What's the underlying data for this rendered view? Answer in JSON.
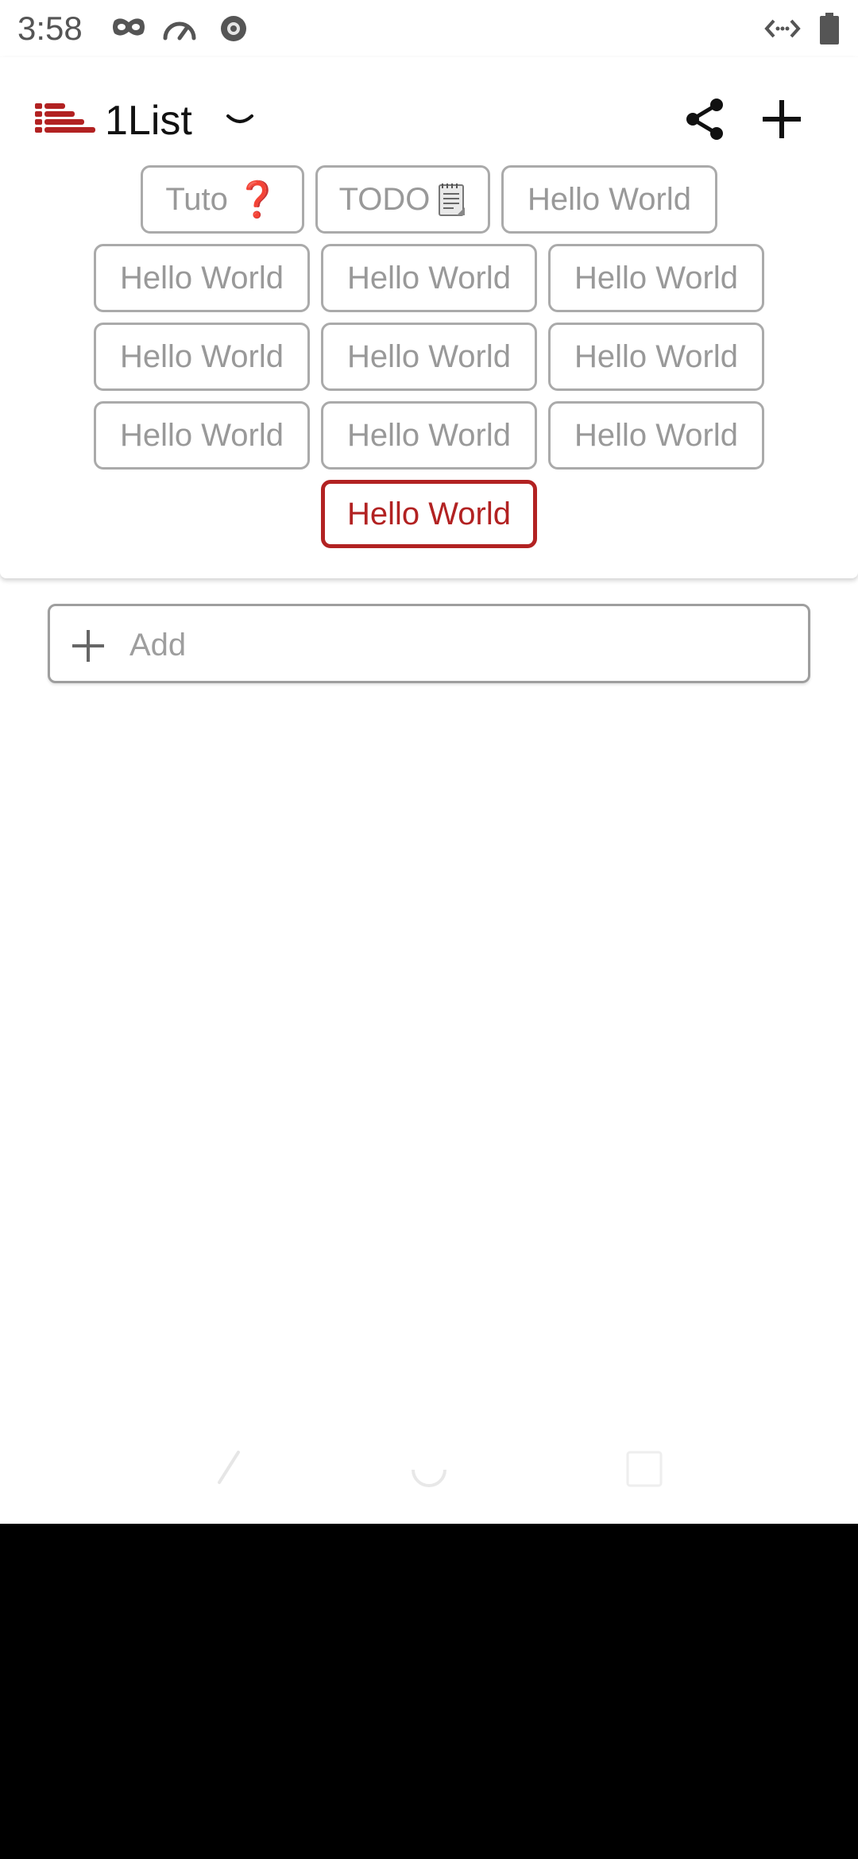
{
  "status_bar": {
    "time": "3:58",
    "icons": [
      "eye-mask-icon",
      "gauge-icon",
      "notification-badge-icon",
      "code-icon",
      "battery-icon"
    ]
  },
  "app_bar": {
    "title": "1List",
    "icons": [
      "list-logo-icon",
      "chevron-down-icon",
      "share-icon",
      "plus-icon"
    ]
  },
  "chips": {
    "row1": [
      {
        "label": "Tuto",
        "glyph": "❓"
      },
      {
        "label": "TODO",
        "glyph": "🗒"
      },
      {
        "label": "Hello World"
      }
    ],
    "row2": [
      "Hello World",
      "Hello World",
      "Hello World"
    ],
    "row3": [
      "Hello World",
      "Hello World",
      "Hello World"
    ],
    "row4": [
      "Hello World",
      "Hello World",
      "Hello World"
    ],
    "row5": [
      "Hello World"
    ]
  },
  "add_item": {
    "placeholder": "Add"
  },
  "colors": {
    "accent": "#b22222",
    "chip_border": "#aaaaaa",
    "chip_text": "#999999",
    "background": "#ffffff",
    "bottom_area": "#000000"
  },
  "nav_bar": {
    "icons": [
      "back-icon",
      "home-icon",
      "recents-icon"
    ]
  }
}
